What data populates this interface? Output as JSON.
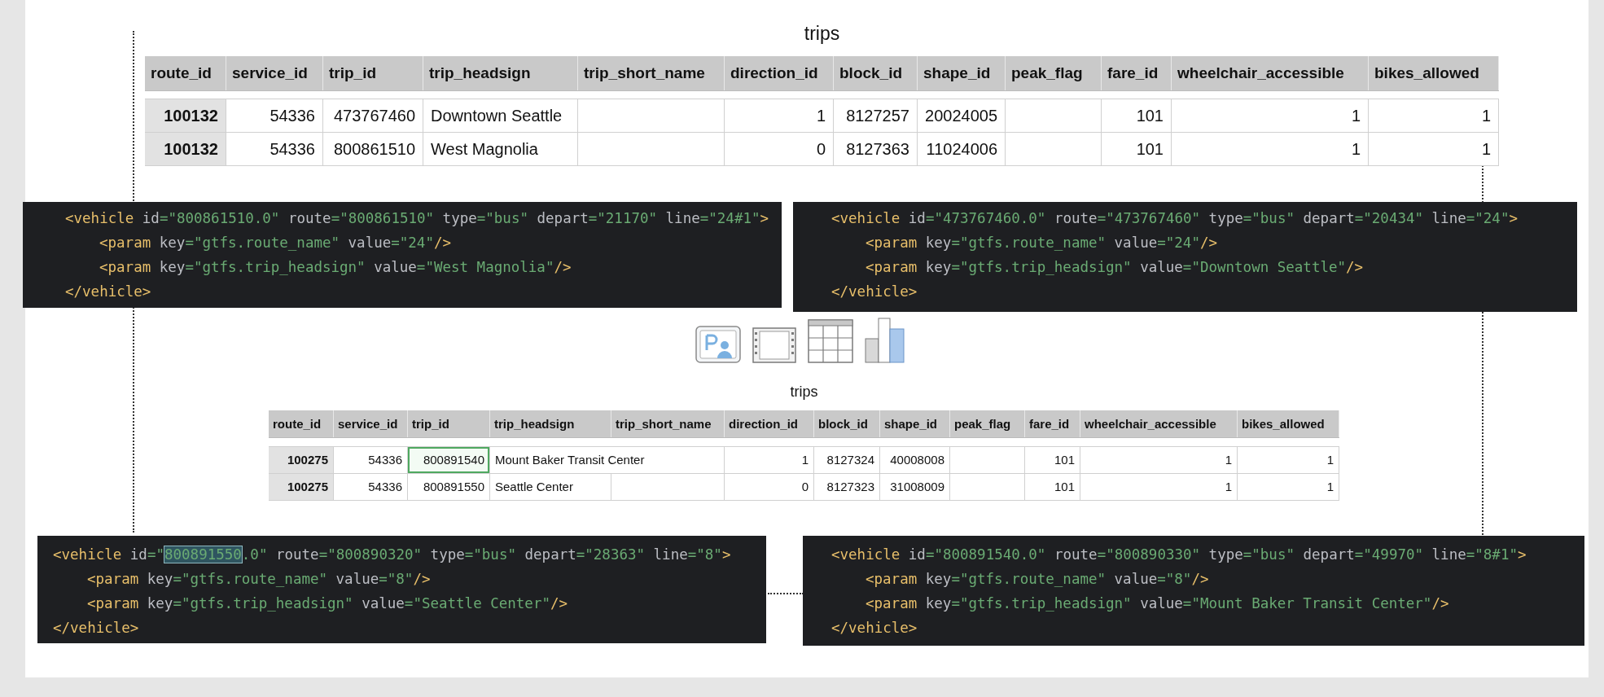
{
  "tables": [
    {
      "title": "trips",
      "columns": [
        {
          "label": "route_id",
          "kind": "key"
        },
        {
          "label": "service_id",
          "kind": "number"
        },
        {
          "label": "trip_id",
          "kind": "number"
        },
        {
          "label": "trip_headsign",
          "kind": "text"
        },
        {
          "label": "trip_short_name",
          "kind": "text"
        },
        {
          "label": "direction_id",
          "kind": "number"
        },
        {
          "label": "block_id",
          "kind": "number"
        },
        {
          "label": "shape_id",
          "kind": "number"
        },
        {
          "label": "peak_flag",
          "kind": "text"
        },
        {
          "label": "fare_id",
          "kind": "number"
        },
        {
          "label": "wheelchair_accessible",
          "kind": "number"
        },
        {
          "label": "bikes_allowed",
          "kind": "number"
        }
      ],
      "rows": [
        {
          "cells": [
            {
              "text": "100132",
              "selected": false
            },
            {
              "text": "54336",
              "selected": false
            },
            {
              "text": "473767460",
              "selected": false
            },
            {
              "text": "Downtown Seattle",
              "selected": false
            },
            {
              "selected": false
            },
            {
              "text": "1",
              "selected": false
            },
            {
              "text": "8127257",
              "selected": false
            },
            {
              "text": "20024005",
              "selected": false
            },
            {
              "selected": false
            },
            {
              "text": "101",
              "selected": false
            },
            {
              "text": "1",
              "selected": false
            },
            {
              "text": "1",
              "selected": false
            }
          ]
        },
        {
          "cells": [
            {
              "text": "100132",
              "selected": false
            },
            {
              "text": "54336",
              "selected": false
            },
            {
              "text": "800861510",
              "selected": false
            },
            {
              "text": "West Magnolia",
              "selected": false
            },
            {
              "selected": false
            },
            {
              "text": "0",
              "selected": false
            },
            {
              "text": "8127363",
              "selected": false
            },
            {
              "text": "11024006",
              "selected": false
            },
            {
              "selected": false
            },
            {
              "text": "101",
              "selected": false
            },
            {
              "text": "1",
              "selected": false
            },
            {
              "text": "1",
              "selected": false
            }
          ]
        }
      ]
    },
    {
      "title": "trips",
      "columns": [
        {
          "label": "route_id",
          "kind": "key"
        },
        {
          "label": "service_id",
          "kind": "number"
        },
        {
          "label": "trip_id",
          "kind": "number"
        },
        {
          "label": "trip_headsign",
          "kind": "text"
        },
        {
          "label": "trip_short_name",
          "kind": "text"
        },
        {
          "label": "direction_id",
          "kind": "number"
        },
        {
          "label": "block_id",
          "kind": "number"
        },
        {
          "label": "shape_id",
          "kind": "number"
        },
        {
          "label": "peak_flag",
          "kind": "text"
        },
        {
          "label": "fare_id",
          "kind": "number"
        },
        {
          "label": "wheelchair_accessible",
          "kind": "number"
        },
        {
          "label": "bikes_allowed",
          "kind": "number"
        }
      ],
      "rows": [
        {
          "cells": [
            {
              "text": "100275",
              "selected": false
            },
            {
              "text": "54336",
              "selected": false
            },
            {
              "text": "800891540",
              "selected": true
            },
            {
              "text": "Mount Baker Transit Center",
              "selected": false
            },
            {
              "selected": false
            },
            {
              "text": "1",
              "selected": false
            },
            {
              "text": "8127324",
              "selected": false
            },
            {
              "text": "40008008",
              "selected": false
            },
            {
              "selected": false
            },
            {
              "text": "101",
              "selected": false
            },
            {
              "text": "1",
              "selected": false
            },
            {
              "text": "1",
              "selected": false
            }
          ]
        },
        {
          "cells": [
            {
              "text": "100275",
              "selected": false
            },
            {
              "text": "54336",
              "selected": false
            },
            {
              "text": "800891550",
              "selected": false
            },
            {
              "text": "Seattle Center",
              "selected": false
            },
            {
              "selected": false
            },
            {
              "text": "0",
              "selected": false
            },
            {
              "text": "8127323",
              "selected": false
            },
            {
              "text": "31008009",
              "selected": false
            },
            {
              "selected": false
            },
            {
              "text": "101",
              "selected": false
            },
            {
              "text": "1",
              "selected": false
            },
            {
              "text": "1",
              "selected": false
            }
          ]
        }
      ]
    }
  ],
  "code_panels": [
    {
      "lines": [
        {
          "parts": [
            {
              "text": "<vehicle id=\"800861510.0\" route=\"800861510\" type=\"bus\" depart=\"21170\" line=\"24#1\">",
              "selected": false
            }
          ],
          "children": [
            {
              "parts": [
                {
                  "text": "<param key=\"gtfs.route_name\" value=\"24\"/>",
                  "selected": false
                }
              ]
            },
            {
              "parts": [
                {
                  "text": "<param key=\"gtfs.trip_headsign\" value=\"West Magnolia\"/>",
                  "selected": false
                }
              ]
            }
          ]
        },
        {
          "parts": [
            {
              "text": "</vehicle>",
              "selected": false
            }
          ]
        }
      ]
    },
    {
      "lines": [
        {
          "parts": [
            {
              "text": "<vehicle id=\"473767460.0\" route=\"473767460\" type=\"bus\" depart=\"20434\" line=\"24\">",
              "selected": false
            }
          ],
          "children": [
            {
              "parts": [
                {
                  "text": "<param key=\"gtfs.route_name\" value=\"24\"/>",
                  "selected": false
                }
              ]
            },
            {
              "parts": [
                {
                  "text": "<param key=\"gtfs.trip_headsign\" value=\"Downtown Seattle\"/>",
                  "selected": false
                }
              ]
            }
          ]
        },
        {
          "parts": [
            {
              "text": "</vehicle>",
              "selected": false
            }
          ]
        }
      ]
    },
    {
      "lines": [
        {
          "parts": [
            {
              "text": "<vehicle id=\"",
              "selected": false
            },
            {
              "text": "800891550",
              "selected": true
            },
            {
              "text": ".0\" route=\"800890320\" type=\"bus\" depart=\"28363\" line=\"8\">",
              "selected": false
            }
          ],
          "children": [
            {
              "parts": [
                {
                  "text": "<param key=\"gtfs.route_name\" value=\"8\"/>",
                  "selected": false
                }
              ]
            },
            {
              "parts": [
                {
                  "text": "<param key=\"gtfs.trip_headsign\" value=\"Seattle Center\"/>",
                  "selected": false
                }
              ]
            }
          ]
        },
        {
          "parts": [
            {
              "text": "</vehicle>",
              "selected": false
            }
          ]
        }
      ]
    },
    {
      "lines": [
        {
          "parts": [
            {
              "text": "<vehicle id=\"800891540.0\" route=\"800890330\" type=\"bus\" depart=\"49970\" line=\"8#1\">",
              "selected": false
            }
          ],
          "children": [
            {
              "parts": [
                {
                  "text": "<param key=\"gtfs.route_name\" value=\"8\"/>",
                  "selected": false
                }
              ]
            },
            {
              "parts": [
                {
                  "text": "<param key=\"gtfs.trip_headsign\" value=\"Mount Baker Transit Center\"/>",
                  "selected": false
                }
              ]
            }
          ]
        },
        {
          "parts": [
            {
              "text": "</vehicle>",
              "selected": false
            }
          ]
        }
      ]
    }
  ]
}
